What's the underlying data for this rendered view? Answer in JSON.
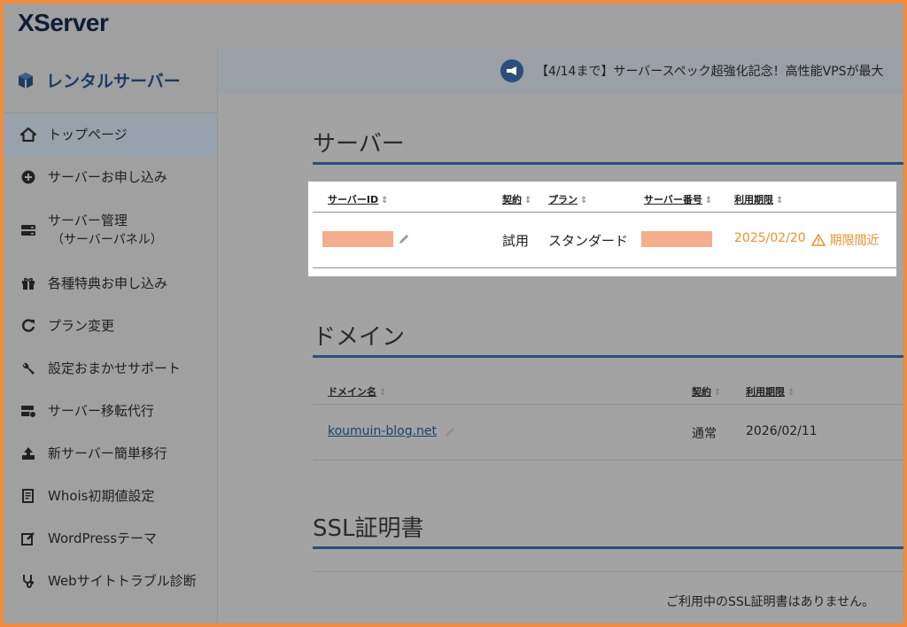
{
  "header": {
    "logo": "XServer"
  },
  "sidebar": {
    "title": "レンタルサーバー",
    "items": [
      {
        "label": "トップページ",
        "icon": "home-icon"
      },
      {
        "label": "サーバーお申し込み",
        "icon": "plus-circle-icon"
      },
      {
        "label": "サーバー管理",
        "sub": "（サーバーパネル）",
        "icon": "server-icon"
      },
      {
        "label": "各種特典お申し込み",
        "icon": "gift-icon"
      },
      {
        "label": "プラン変更",
        "icon": "refresh-icon"
      },
      {
        "label": "設定おまかせサポート",
        "icon": "wrench-icon"
      },
      {
        "label": "サーバー移転代行",
        "icon": "server-transfer-icon"
      },
      {
        "label": "新サーバー簡単移行",
        "icon": "upload-icon"
      },
      {
        "label": "Whois初期値設定",
        "icon": "document-icon"
      },
      {
        "label": "WordPressテーマ",
        "icon": "edit-icon"
      },
      {
        "label": "Webサイトトラブル診断",
        "icon": "stethoscope-icon"
      }
    ]
  },
  "announcement": {
    "text": "【4/14まで】サーバースペック超強化記念！高性能VPSが最大"
  },
  "server": {
    "title": "サーバー",
    "columns": {
      "id": "サーバーID",
      "contract": "契約",
      "plan": "プラン",
      "number": "サーバー番号",
      "expiry": "利用期限"
    },
    "row": {
      "contract": "試用",
      "plan": "スタンダード",
      "expiry": "2025/02/20",
      "warning": "期限間近"
    },
    "colors": {
      "warning": "#e8922e",
      "redacted": "#f3ae8c"
    }
  },
  "domain": {
    "title": "ドメイン",
    "columns": {
      "name": "ドメイン名",
      "contract": "契約",
      "expiry": "利用期限"
    },
    "row": {
      "name": "koumuin-blog.net",
      "contract": "通常",
      "expiry": "2026/02/11"
    }
  },
  "ssl": {
    "title": "SSL証明書",
    "empty_message": "ご利用中のSSL証明書はありません。"
  },
  "colors": {
    "frame": "#f08a3c",
    "accent": "#2d4f78"
  }
}
